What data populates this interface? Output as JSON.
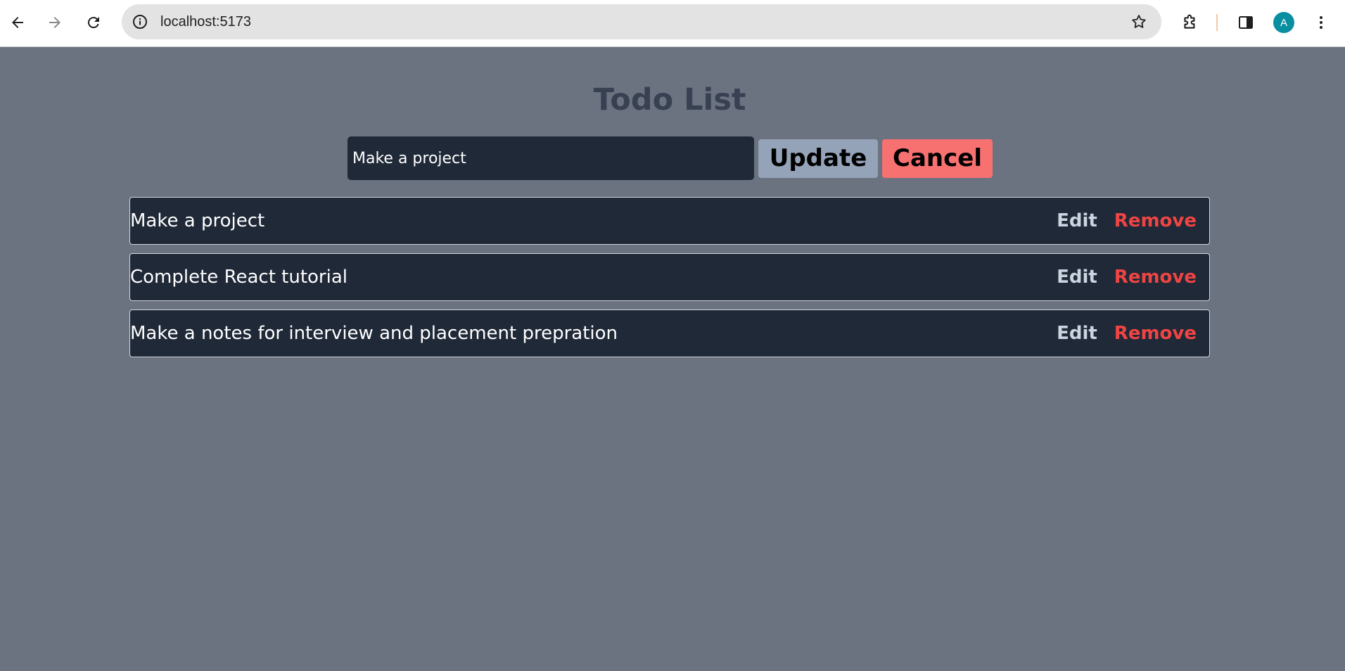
{
  "browser": {
    "url": "localhost:5173",
    "avatar_letter": "A",
    "icons": {
      "back": "arrow-left-icon",
      "forward": "arrow-right-icon",
      "reload": "reload-icon",
      "site_info": "info-icon",
      "bookmark": "star-icon",
      "extensions": "puzzle-icon",
      "side_panel": "side-panel-icon",
      "menu": "kebab-menu-icon"
    }
  },
  "app": {
    "title": "Todo List",
    "input": {
      "value": "Make a project"
    },
    "update_label": "Update",
    "cancel_label": "Cancel",
    "todos": [
      {
        "text": "Make a project",
        "edit_label": "Edit",
        "remove_label": "Remove"
      },
      {
        "text": "Complete React tutorial",
        "edit_label": "Edit",
        "remove_label": "Remove"
      },
      {
        "text": "Make a notes for interview and placement prepration",
        "edit_label": "Edit",
        "remove_label": "Remove"
      }
    ]
  },
  "colors": {
    "page_bg": "#6b7280",
    "item_bg": "#1f2937",
    "title": "#374151",
    "update_bg": "#94a3b8",
    "cancel_bg": "#f87171",
    "edit_text": "#cbd5e1",
    "remove_text": "#ef4444",
    "avatar_bg": "#0a8fa0"
  }
}
